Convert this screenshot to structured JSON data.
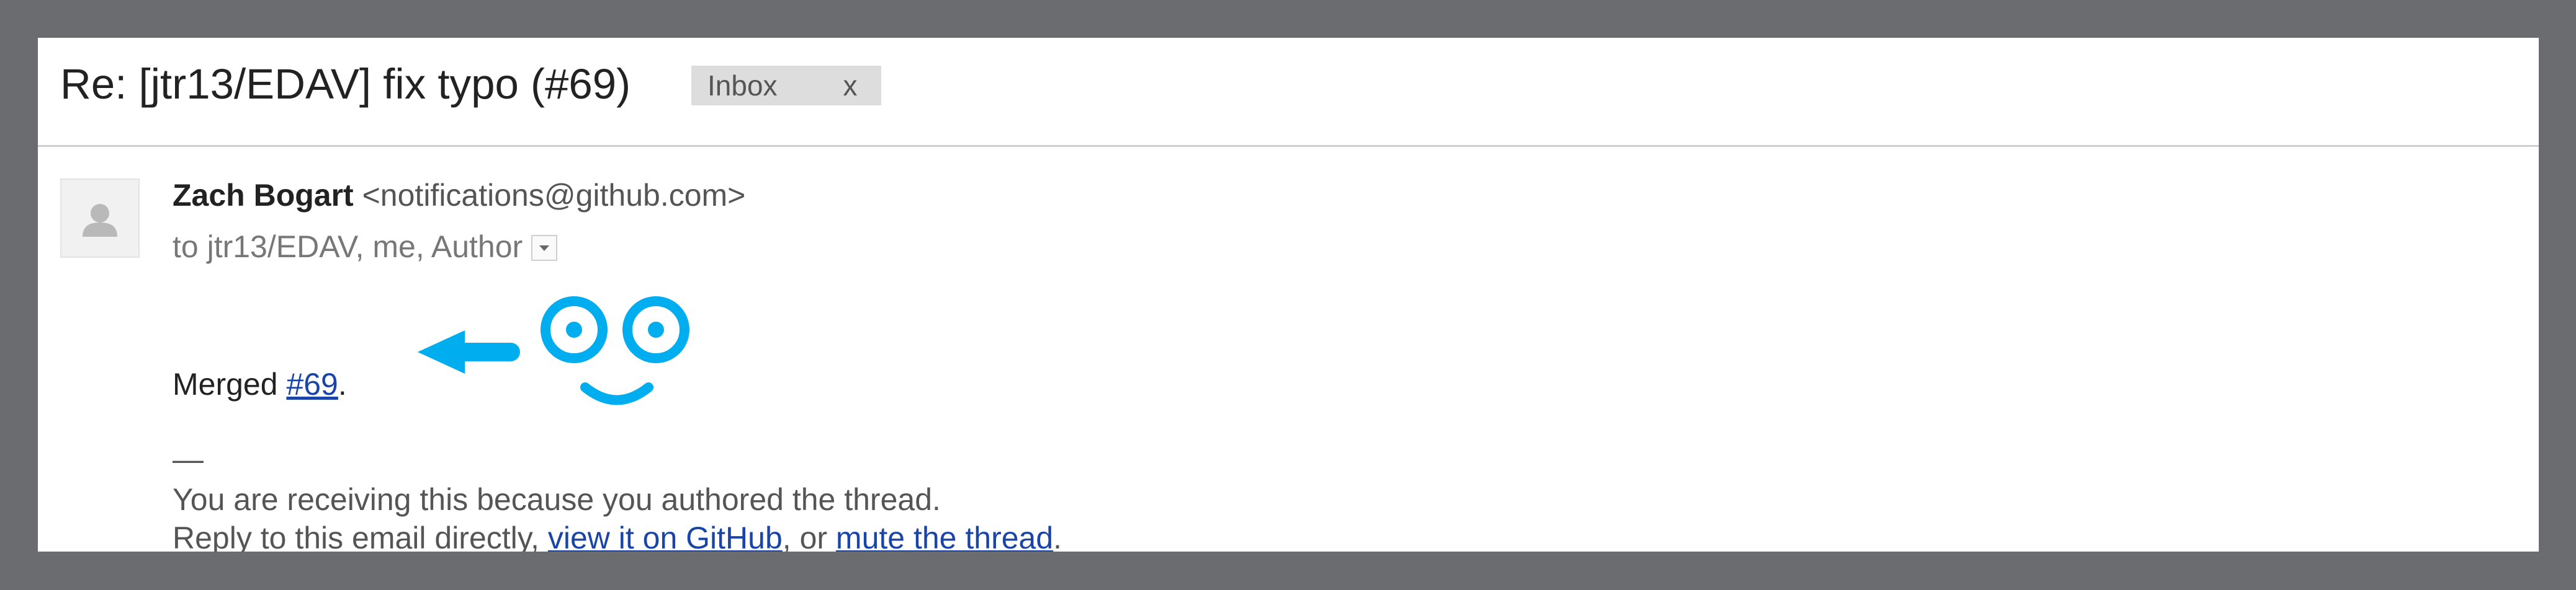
{
  "email": {
    "subject": "Re: [jtr13/EDAV] fix typo (#69)",
    "label": {
      "name": "Inbox",
      "remove": "x"
    },
    "sender": {
      "name": "Zach Bogart",
      "email": "<notifications@github.com>"
    },
    "recipients": "to jtr13/EDAV, me, Author",
    "body": {
      "merged_prefix": "Merged ",
      "merged_link": "#69",
      "merged_suffix": "."
    },
    "signature_dash": "—",
    "footer": {
      "line1": "You are receiving this because you authored the thread.",
      "line2_prefix": "Reply to this email directly, ",
      "link_github": "view it on GitHub",
      "line2_middle": ", or ",
      "link_mute": "mute the thread",
      "line2_suffix": "."
    }
  },
  "colors": {
    "background": "#6b6c70",
    "link": "#1a44a8",
    "annotation": "#00aeef"
  },
  "icons": {
    "avatar": "person-silhouette-icon",
    "details": "caret-down-icon",
    "arrow": "left-arrow-icon",
    "face": "smiley-face-icon"
  }
}
